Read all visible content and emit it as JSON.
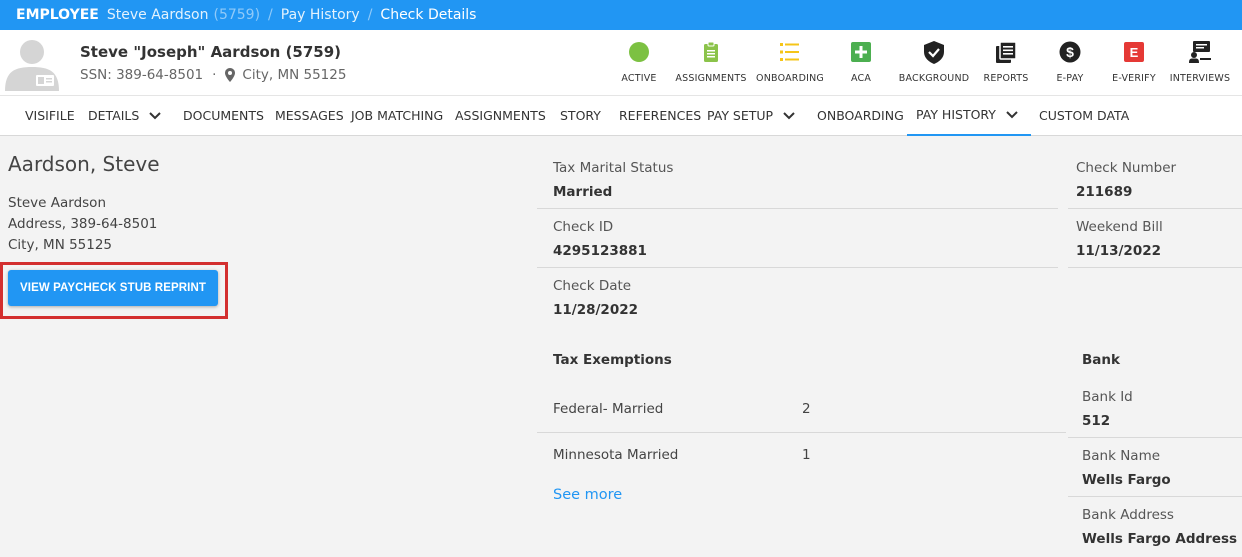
{
  "breadcrumb": {
    "section": "EMPLOYEE",
    "employee": "Steve Aardson",
    "employee_id": "(5759)",
    "pay_history": "Pay History",
    "current": "Check Details",
    "sep": "/"
  },
  "employee": {
    "display_name": "Steve \"Joseph\" Aardson (5759)",
    "ssn": "SSN: 389-64-8501",
    "location": "City, MN 55125"
  },
  "status_icons": [
    {
      "label": "ACTIVE",
      "icon": "active-circle-icon",
      "color": "#7cc142"
    },
    {
      "label": "ASSIGNMENTS",
      "icon": "clipboard-icon",
      "color": "#8bc34a"
    },
    {
      "label": "ONBOARDING",
      "icon": "list-icon",
      "color": "#f5c518"
    },
    {
      "label": "ACA",
      "icon": "plus-square-icon",
      "color": "#4caf50"
    },
    {
      "label": "BACKGROUND",
      "icon": "shield-check-icon",
      "color": "#222222"
    },
    {
      "label": "REPORTS",
      "icon": "documents-icon",
      "color": "#222222"
    },
    {
      "label": "E-PAY",
      "icon": "dollar-circle-icon",
      "color": "#222222"
    },
    {
      "label": "E-VERIFY",
      "icon": "e-verify-icon",
      "color": "#e53935"
    },
    {
      "label": "INTERVIEWS",
      "icon": "interview-icon",
      "color": "#222222"
    }
  ],
  "tabs": [
    "VISIFILE",
    "DETAILS",
    "DOCUMENTS",
    "MESSAGES",
    "JOB MATCHING",
    "ASSIGNMENTS",
    "STORY",
    "REFERENCES",
    "PAY SETUP",
    "ONBOARDING",
    "PAY HISTORY",
    "CUSTOM DATA"
  ],
  "left": {
    "title": "Aardson, Steve",
    "line1": "Steve  Aardson",
    "line2": "Address,  389-64-8501",
    "line3": "City, MN  55125",
    "button": "VIEW PAYCHECK STUB REPRINT"
  },
  "check": {
    "tax_marital_status_label": "Tax Marital Status",
    "tax_marital_status": "Married",
    "check_id_label": "Check ID",
    "check_id": "4295123881",
    "check_date_label": "Check Date",
    "check_date": "11/28/2022",
    "check_number_label": "Check Number",
    "check_number": "211689",
    "weekend_bill_label": "Weekend Bill",
    "weekend_bill": "11/13/2022"
  },
  "exemptions": {
    "title": "Tax Exemptions",
    "rows": [
      {
        "name": "Federal- Married",
        "count": "2"
      },
      {
        "name": "Minnesota Married",
        "count": "1"
      }
    ],
    "see_more": "See more"
  },
  "bank": {
    "title": "Bank",
    "id_label": "Bank Id",
    "id": "512",
    "name_label": "Bank Name",
    "name": "Wells Fargo",
    "address_label": "Bank Address",
    "address": "Wells Fargo Address"
  },
  "colors": {
    "accent": "#2196f3",
    "highlight": "#d32f2f"
  }
}
